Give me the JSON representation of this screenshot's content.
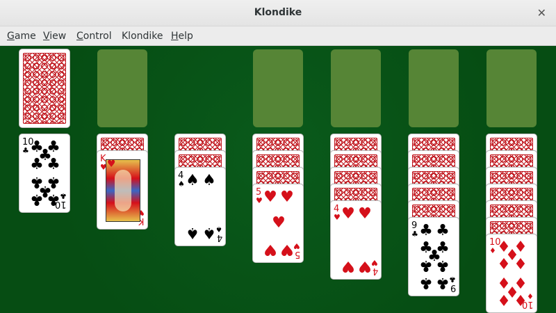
{
  "window": {
    "title": "Klondike",
    "close_icon": "close-icon"
  },
  "menu": [
    {
      "label": "Game",
      "mnemonic": "G"
    },
    {
      "label": "View",
      "mnemonic": "V"
    },
    {
      "label": "Control",
      "mnemonic": "C"
    },
    {
      "label": "Klondike",
      "mnemonic": ""
    },
    {
      "label": "Help",
      "mnemonic": "H"
    }
  ],
  "game": {
    "stock": {
      "face_down_cards": 1
    },
    "waste": {
      "cards": []
    },
    "foundations": [
      {
        "cards": []
      },
      {
        "cards": []
      },
      {
        "cards": []
      },
      {
        "cards": []
      }
    ],
    "tableau": [
      {
        "face_down": 0,
        "face_up": [
          {
            "rank": "10",
            "suit": "clubs",
            "symbol": "♣",
            "color": "black"
          }
        ]
      },
      {
        "face_down": 1,
        "face_up": [
          {
            "rank": "K",
            "suit": "hearts",
            "symbol": "♥",
            "color": "red"
          }
        ]
      },
      {
        "face_down": 2,
        "face_up": [
          {
            "rank": "4",
            "suit": "spades",
            "symbol": "♠",
            "color": "black"
          }
        ]
      },
      {
        "face_down": 3,
        "face_up": [
          {
            "rank": "5",
            "suit": "hearts",
            "symbol": "♥",
            "color": "red"
          }
        ]
      },
      {
        "face_down": 4,
        "face_up": [
          {
            "rank": "4",
            "suit": "hearts",
            "symbol": "♥",
            "color": "red"
          }
        ]
      },
      {
        "face_down": 5,
        "face_up": [
          {
            "rank": "9",
            "suit": "clubs",
            "symbol": "♣",
            "color": "black"
          }
        ]
      },
      {
        "face_down": 6,
        "face_up": [
          {
            "rank": "10",
            "suit": "diamonds",
            "symbol": "♦",
            "color": "red"
          }
        ]
      }
    ]
  },
  "colors": {
    "felt": "#064d13",
    "slot": "#568536",
    "card_back": "#c0171e",
    "red_suit": "#d5101a"
  }
}
